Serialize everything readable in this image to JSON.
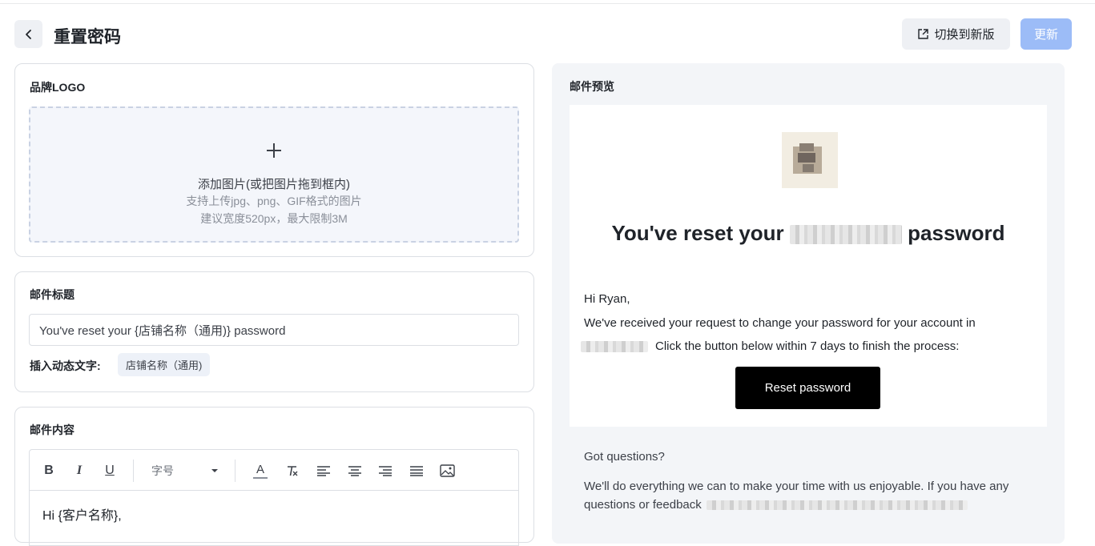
{
  "header": {
    "title": "重置密码",
    "switch_label": "切换到新版",
    "update_label": "更新"
  },
  "logo_section": {
    "title": "品牌LOGO",
    "dropzone_line1": "添加图片(或把图片拖到框内)",
    "dropzone_line2": "支持上传jpg、png、GIF格式的图片",
    "dropzone_line3": "建议宽度520px，最大限制3M"
  },
  "subject_section": {
    "title": "邮件标题",
    "input_value": "You've reset your {店铺名称（通用)} password",
    "insert_label": "插入动态文字:",
    "tag_label": "店铺名称（通用)"
  },
  "content_section": {
    "title": "邮件内容",
    "toolbar": {
      "bold": "B",
      "italic": "I",
      "underline": "U",
      "font_size_label": "字号",
      "font_color": "A"
    },
    "editor_text": "Hi {客户名称},"
  },
  "preview": {
    "title": "邮件预览",
    "heading_before": "You've reset your",
    "heading_after": "password",
    "greeting": "Hi Ryan,",
    "paragraph1": "We've received your request to change your password for your account in",
    "paragraph2": "Click the button below within 7 days to finish the process:",
    "button_label": "Reset password",
    "got_questions": "Got questions?",
    "footer_line1": "We'll do everything we can to make your time with us enjoyable. If you have any",
    "footer_line2": "questions or feedback"
  },
  "icons": {
    "back": "chevron-left-icon",
    "switch": "external-link-icon",
    "upload": "plus-icon"
  },
  "colors": {
    "primary_disabled": "#9cbcf7",
    "button_gray": "#eef0f4",
    "preview_bg": "#f3f5f8"
  }
}
